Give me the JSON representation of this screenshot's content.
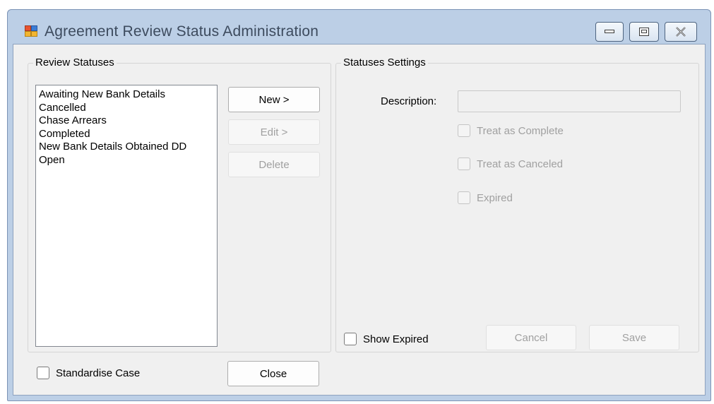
{
  "window": {
    "title": "Agreement Review Status Administration",
    "icons": {
      "app": "app-window-icon",
      "minimize": "minimize-icon",
      "maximize": "maximize-icon",
      "close": "close-icon"
    }
  },
  "review_statuses": {
    "caption": "Review Statuses",
    "items": [
      "Awaiting New Bank Details",
      "Cancelled",
      "Chase Arrears",
      "Completed",
      "New Bank Details Obtained DD",
      "Open"
    ],
    "new_label": "New >",
    "edit_label": "Edit >",
    "delete_label": "Delete"
  },
  "settings": {
    "caption": "Statuses Settings",
    "description_label": "Description:",
    "description_value": "",
    "treat_complete_label": "Treat as Complete",
    "treat_complete_checked": false,
    "treat_canceled_label": "Treat as Canceled",
    "treat_canceled_checked": false,
    "expired_label": "Expired",
    "expired_checked": false,
    "show_expired_label": "Show Expired",
    "show_expired_checked": false,
    "cancel_label": "Cancel",
    "save_label": "Save"
  },
  "footer": {
    "standardise_label": "Standardise Case",
    "standardise_checked": false,
    "close_label": "Close"
  }
}
